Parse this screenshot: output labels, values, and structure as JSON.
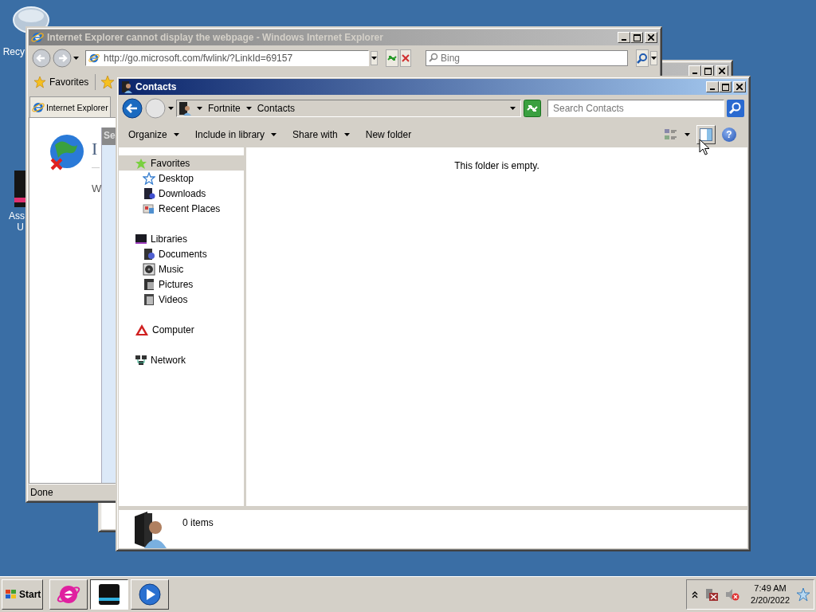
{
  "desktop_icons": [
    {
      "lines": [
        "Recy"
      ]
    },
    {
      "lines": [
        "Ass",
        "U"
      ]
    }
  ],
  "ie_window": {
    "title": "Internet Explorer cannot display the webpage - Windows Internet Explorer",
    "address": "http://go.microsoft.com/fwlink/?LinkId=69157",
    "search": {
      "placeholder": "Bing"
    },
    "favorites": "Favorites",
    "tab": "Internet Explorer",
    "page_heading": "I",
    "page_text": "W",
    "side_panel_title": "Se",
    "status": "Done"
  },
  "contacts_window": {
    "title": "Contacts",
    "breadcrumb": [
      "Fortnite",
      "Contacts"
    ],
    "search": {
      "placeholder": "Search Contacts"
    },
    "toolbar": [
      {
        "label": "Organize",
        "dropdown": true
      },
      {
        "label": "Include in library",
        "dropdown": true
      },
      {
        "label": "Share with",
        "dropdown": true
      },
      {
        "label": "New folder",
        "dropdown": false
      }
    ],
    "help": "?",
    "navigation": [
      {
        "label": "Favorites",
        "selected": true,
        "children": [
          {
            "label": "Desktop",
            "selected": false
          },
          {
            "label": "Downloads",
            "selected": false
          },
          {
            "label": "Recent Places",
            "selected": false
          }
        ]
      },
      {
        "label": "Libraries",
        "selected": false,
        "children": [
          {
            "label": "Documents",
            "selected": false
          },
          {
            "label": "Music",
            "selected": false
          },
          {
            "label": "Pictures",
            "selected": false
          },
          {
            "label": "Videos",
            "selected": false
          }
        ]
      },
      {
        "label": "Computer",
        "selected": false
      },
      {
        "label": "Network",
        "selected": false
      }
    ],
    "empty_message": "This folder is empty.",
    "details": "0 items"
  },
  "taskbar": {
    "start": "Start",
    "buttons": [
      {
        "selected": false
      },
      {
        "selected": true
      },
      {
        "selected": false
      }
    ],
    "time": "7:49 AM",
    "date": "2/20/2022"
  }
}
